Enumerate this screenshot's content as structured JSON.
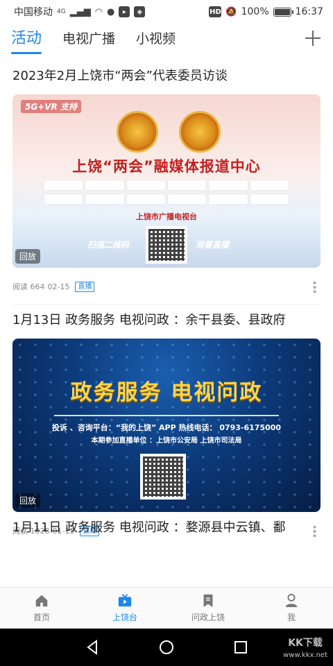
{
  "status_bar": {
    "carrier": "中国移动",
    "network": "4G",
    "battery_text": "100%",
    "battery_level": 1.0,
    "time": "16:37",
    "hd_label": "HD"
  },
  "tabs": [
    {
      "label": "活动",
      "active": true
    },
    {
      "label": "电视广播",
      "active": false
    },
    {
      "label": "小视频",
      "active": false
    }
  ],
  "feed": [
    {
      "title": "2023年2月上饶市“两会”代表委员访谈",
      "media": {
        "tag": "5G+VR 支持",
        "headline": "上饶“两会”融媒体报道中心",
        "org": "上饶市广播电视台",
        "cta_left": "扫描二维码",
        "cta_right": "观看直播",
        "badge": "回放"
      },
      "reads": "阅读 664",
      "date": "02-15",
      "live_tag": "直播"
    },
    {
      "title": "1月13日 政务服务 电视问政 ：余干县委、县政府",
      "media": {
        "headline": "政务服务 电视问政",
        "line1": "投诉 、咨询平台：“我的上饶” APP  热线电话： 0793-6175000",
        "line2": "本期参加直播单位 ：上饶市公安局  上饶市司法局",
        "badge": "回放"
      },
      "reads": "阅读 1028",
      "date": "01-13",
      "live_tag": "直播"
    },
    {
      "title": "1月11日 政务服务 电视问政 ：婺源县中云镇、鄱"
    }
  ],
  "bottom_nav": [
    {
      "label": "首页",
      "icon": "home-icon",
      "active": false
    },
    {
      "label": "上饶台",
      "icon": "tv-icon",
      "active": true
    },
    {
      "label": "问政上饶",
      "icon": "bookmark-icon",
      "active": false
    },
    {
      "label": "我",
      "icon": "person-icon",
      "active": false
    }
  ],
  "watermark": {
    "main": "KK下载",
    "sub": "www.kkx.net"
  },
  "colors": {
    "accent": "#1e88e5",
    "title_red": "#c41f1f",
    "gold": "#ffd54a"
  }
}
